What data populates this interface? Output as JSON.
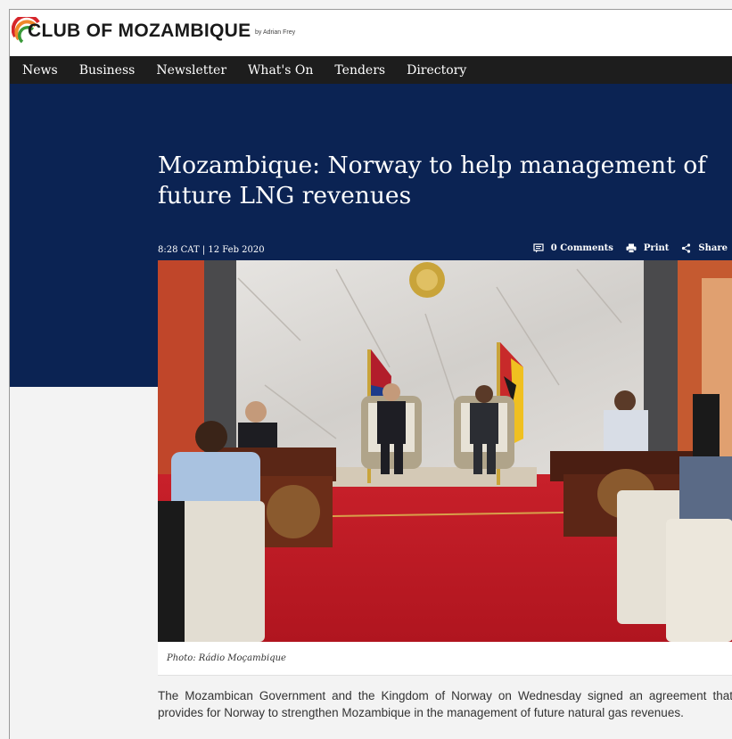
{
  "site": {
    "logo_text": "CLUB OF MOZAMBIQUE",
    "byline": "by Adrian Frey",
    "brand_colors": {
      "orange": "#f0882b",
      "red": "#d6262b",
      "green": "#3a9a3a",
      "navy": "#0b2353"
    }
  },
  "nav": {
    "items": [
      {
        "label": "News"
      },
      {
        "label": "Business"
      },
      {
        "label": "Newsletter"
      },
      {
        "label": "What's On"
      },
      {
        "label": "Tenders"
      },
      {
        "label": "Directory"
      }
    ]
  },
  "article": {
    "title": "Mozambique: Norway to help management of future LNG revenues",
    "timestamp": "8:28 CAT | 12 Feb 2020",
    "actions": {
      "comments": "0 Comments",
      "print": "Print",
      "share": "Share"
    },
    "photo_caption": "Photo: Rádio Moçambique",
    "body": "The Mozambican Government and the Kingdom of Norway on Wednesday signed an agreement that provides for Norway to strengthen Mozambique in the management of future natural gas revenues."
  },
  "icons": [
    "comment-icon",
    "print-icon",
    "share-icon",
    "logo-arc-icon"
  ]
}
